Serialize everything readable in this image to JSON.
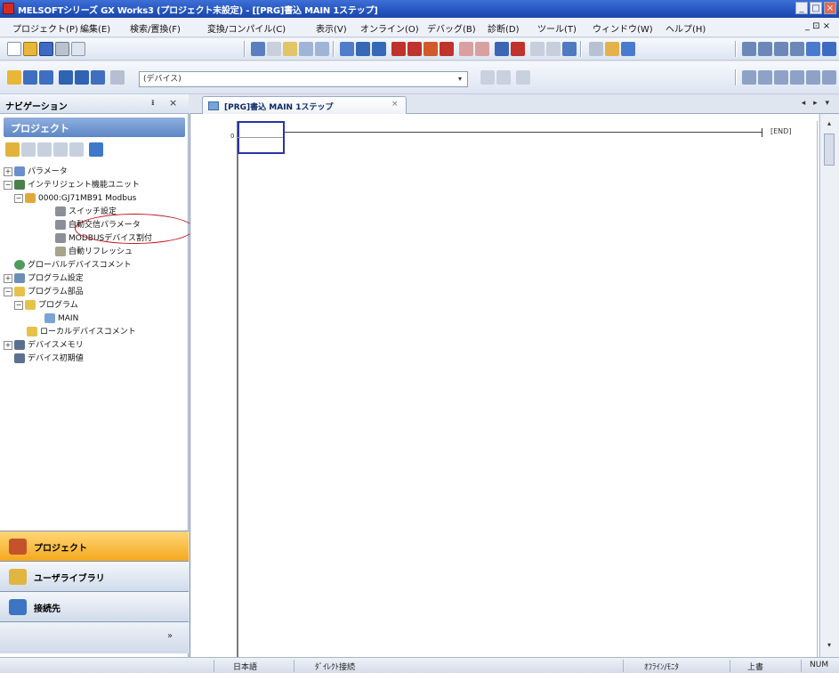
{
  "titlebar": {
    "title": "MELSOFTシリーズ GX Works3 (プロジェクト未設定) - [[PRG]書込 MAIN 1ステップ]",
    "min": "_",
    "max": "□",
    "close": "×"
  },
  "menubar": {
    "items": [
      "プロジェクト(P)",
      "編集(E)",
      "検索/置換(F)",
      "変換/コンパイル(C)",
      "表示(V)",
      "オンライン(O)",
      "デバッグ(B)",
      "診断(D)",
      "ツール(T)",
      "ウィンドウ(W)",
      "ヘルプ(H)"
    ],
    "right_controls": "_ ⊡ ×"
  },
  "toolbar2": {
    "device_combo_value": "(デバイス)",
    "combo_arrow": "▾"
  },
  "navigation": {
    "header": "ナビゲーション",
    "pin": "ᵻ",
    "close": "×",
    "section": "プロジェクト",
    "tree": [
      {
        "label": "パラメータ",
        "level": 0,
        "expander": "+"
      },
      {
        "label": "インテリジェント機能ユニット",
        "level": 0,
        "expander": "−"
      },
      {
        "label": "0000:GJ71MB91 Modbus",
        "level": 1,
        "expander": "−"
      },
      {
        "label": "スイッチ設定",
        "level": 2,
        "expander": ""
      },
      {
        "label": "自動交信パラメータ",
        "level": 2,
        "expander": ""
      },
      {
        "label": "MODBUSデバイス割付",
        "level": 2,
        "expander": ""
      },
      {
        "label": "自動リフレッシュ",
        "level": 2,
        "expander": ""
      },
      {
        "label": "グローバルデバイスコメント",
        "level": 0,
        "expander": ""
      },
      {
        "label": "プログラム設定",
        "level": 0,
        "expander": "+"
      },
      {
        "label": "プログラム部品",
        "level": 0,
        "expander": "−"
      },
      {
        "label": "プログラム",
        "level": 1,
        "expander": "−"
      },
      {
        "label": "MAIN",
        "level": 2,
        "expander": ""
      },
      {
        "label": "ローカルデバイスコメント",
        "level": 1,
        "expander": ""
      },
      {
        "label": "デバイスメモリ",
        "level": 0,
        "expander": "+"
      },
      {
        "label": "デバイス初期値",
        "level": 0,
        "expander": ""
      }
    ],
    "hscroll_left": "◂",
    "hscroll_right": "▸",
    "bars": {
      "project": "プロジェクト",
      "library": "ユーザライブラリ",
      "connection": "接続先",
      "bottom_chevron": "»"
    }
  },
  "editor": {
    "tab_label": "[PRG]書込 MAIN 1ステップ",
    "tab_close": "×",
    "tab_scroll": "◂ ▸ ▾",
    "step_number": "0",
    "end_label": "[END]"
  },
  "vscroll": {
    "up": "▴",
    "down": "▾"
  },
  "statusbar": {
    "language": "日本語",
    "mode": "ﾀﾞｲﾚｸﾄ接続",
    "info": "ｵﾌﾗｲﾝ/ﾓﾆﾀ",
    "overwrite": "上書",
    "num": "NUM"
  }
}
